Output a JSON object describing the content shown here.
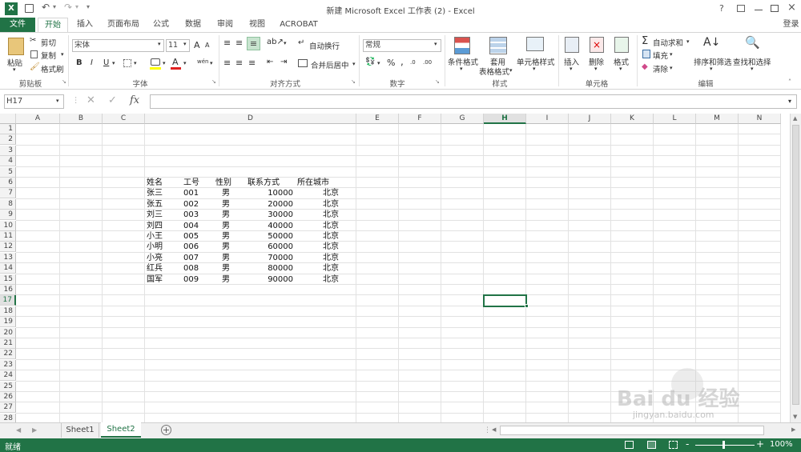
{
  "window": {
    "title": "新建 Microsoft Excel 工作表 (2) - Excel",
    "login": "登录",
    "help": "?",
    "accent": "#217346"
  },
  "tabs": [
    "文件",
    "开始",
    "插入",
    "页面布局",
    "公式",
    "数据",
    "审阅",
    "视图",
    "ACROBAT"
  ],
  "ribbon": {
    "clipboard": {
      "paste": "粘贴",
      "cut": "剪切",
      "copy": "复制",
      "format_painter": "格式刷",
      "label": "剪贴板"
    },
    "font": {
      "name": "宋体",
      "size": "11",
      "bold": "B",
      "italic": "I",
      "underline": "U",
      "grow": "A",
      "shrink": "A",
      "label": "字体",
      "font_color": "A",
      "phonetic": "wén"
    },
    "alignment": {
      "wrap": "自动换行",
      "merge": "合并后居中",
      "label": "对齐方式"
    },
    "number": {
      "format": "常规",
      "percent": "%",
      "comma": ",",
      "inc": ".0",
      "dec": ".00",
      "label": "数字"
    },
    "styles": {
      "conditional": "条件格式",
      "table_1": "套用",
      "table_2": "表格格式",
      "cell_styles": "单元格样式",
      "label": "样式"
    },
    "cells": {
      "insert": "插入",
      "delete": "删除",
      "format": "格式",
      "label": "单元格"
    },
    "editing": {
      "autosum": "自动求和",
      "fill": "填充",
      "clear": "清除",
      "sort": "排序和筛选",
      "find": "查找和选择",
      "label": "编辑"
    }
  },
  "formula_bar": {
    "name_box": "H17",
    "fx": "fx",
    "value": ""
  },
  "sheet": {
    "columns": [
      "A",
      "B",
      "C",
      "D",
      "E",
      "F",
      "G",
      "H",
      "I",
      "J",
      "K",
      "L",
      "M",
      "N"
    ],
    "rows": [
      "1",
      "2",
      "3",
      "4",
      "5",
      "6",
      "7",
      "8",
      "9",
      "10",
      "11",
      "12",
      "13",
      "14",
      "15",
      "16",
      "17",
      "18",
      "19",
      "20",
      "21",
      "22",
      "23",
      "24",
      "25",
      "26",
      "27",
      "28"
    ],
    "selected_cell": "H17",
    "table": {
      "headers": [
        "姓名",
        "工号",
        "性别",
        "联系方式",
        "所在城市"
      ],
      "rows": [
        [
          "张三",
          "001",
          "男",
          "10000",
          "北京"
        ],
        [
          "张五",
          "002",
          "男",
          "20000",
          "北京"
        ],
        [
          "刘三",
          "003",
          "男",
          "30000",
          "北京"
        ],
        [
          "刘四",
          "004",
          "男",
          "40000",
          "北京"
        ],
        [
          "小王",
          "005",
          "男",
          "50000",
          "北京"
        ],
        [
          "小明",
          "006",
          "男",
          "60000",
          "北京"
        ],
        [
          "小亮",
          "007",
          "男",
          "70000",
          "北京"
        ],
        [
          "红兵",
          "008",
          "男",
          "80000",
          "北京"
        ],
        [
          "国军",
          "009",
          "男",
          "90000",
          "北京"
        ]
      ]
    }
  },
  "sheet_tabs": [
    "Sheet1",
    "Sheet2"
  ],
  "active_sheet": "Sheet2",
  "status": {
    "ready": "就绪",
    "zoom": "100%",
    "zoom_minus": "-",
    "zoom_plus": "+"
  },
  "watermark": {
    "brand": "Bai du 经验",
    "url": "jingyan.baidu.com"
  }
}
